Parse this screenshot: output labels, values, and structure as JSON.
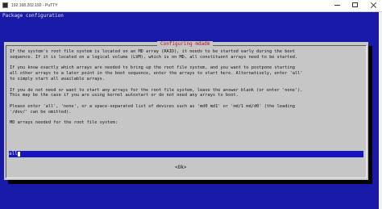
{
  "window": {
    "title": "192.168.202.192 - PuTTY"
  },
  "terminal": {
    "header": "Package configuration",
    "bg_color": "#1a1aa8"
  },
  "dialog": {
    "title": "Configuring mdadm",
    "paragraphs": [
      "If the system's root file system is located on an MD array (RAID), it needs to be started early during the boot\nsequence. If it is located on a logical volume (LVM), which is on MD, all constituent arrays need to be started.",
      "If you know exactly which arrays are needed to bring up the root file system, and you want to postpone starting\nall other arrays to a later point in the boot sequence, enter the arrays to start here. Alternatively, enter 'all'\nto simply start all available arrays.",
      "If you do not need or want to start any arrays for the root file system, leave the answer blank (or enter 'none').\nThis may be the case if you are using kernel autostart or do not need any arrays to boot.",
      "Please enter 'all', 'none', or a space-separated list of devices such as 'md0 md1' or 'md/1 md/d0' (the leading\n'/dev/' can be omitted).",
      "MD arrays needed for the root file system:"
    ],
    "input_value": "all",
    "ok_label": "<Ok>"
  }
}
